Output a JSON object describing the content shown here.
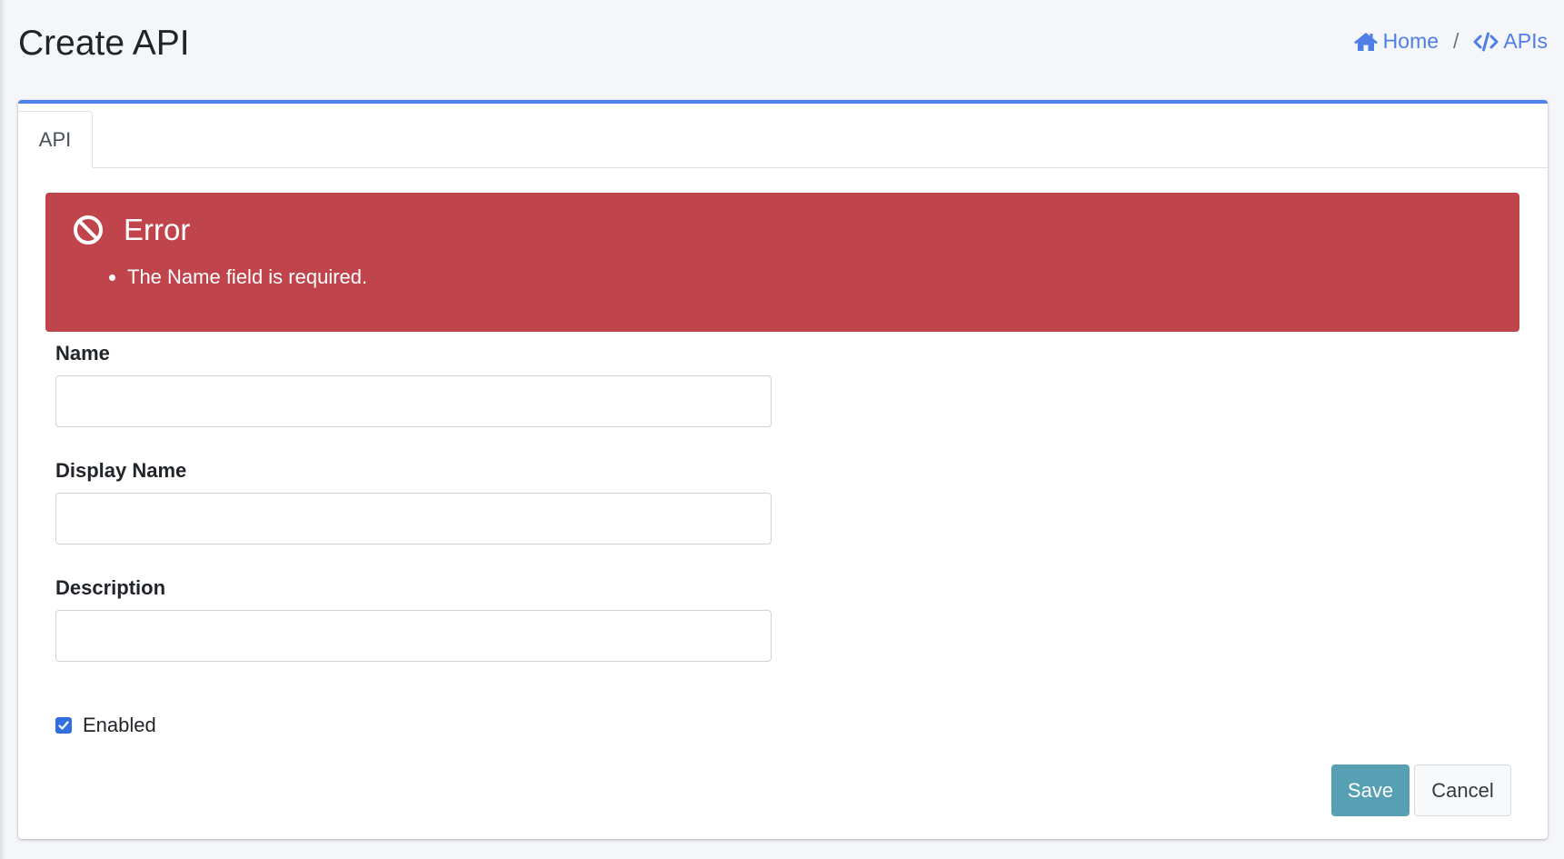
{
  "header": {
    "title": "Create API",
    "breadcrumb": {
      "home_label": "Home",
      "separator": "/",
      "current_label": "APIs"
    }
  },
  "tabs": [
    {
      "label": "API",
      "active": true
    }
  ],
  "alert": {
    "heading": "Error",
    "messages": [
      "The Name field is required."
    ]
  },
  "form": {
    "name": {
      "label": "Name",
      "value": ""
    },
    "display_name": {
      "label": "Display Name",
      "value": ""
    },
    "description": {
      "label": "Description",
      "value": ""
    },
    "enabled": {
      "label": "Enabled",
      "checked": true
    }
  },
  "actions": {
    "save_label": "Save",
    "cancel_label": "Cancel"
  },
  "colors": {
    "accent": "#5083ea",
    "link": "#4f7fe6",
    "error": "#c0444b",
    "save_button": "#57a0b3",
    "background": "#f4f6f9"
  },
  "icons": {
    "home": "home-icon",
    "apis": "code-icon",
    "error": "ban-icon",
    "checkbox": "check-icon"
  }
}
